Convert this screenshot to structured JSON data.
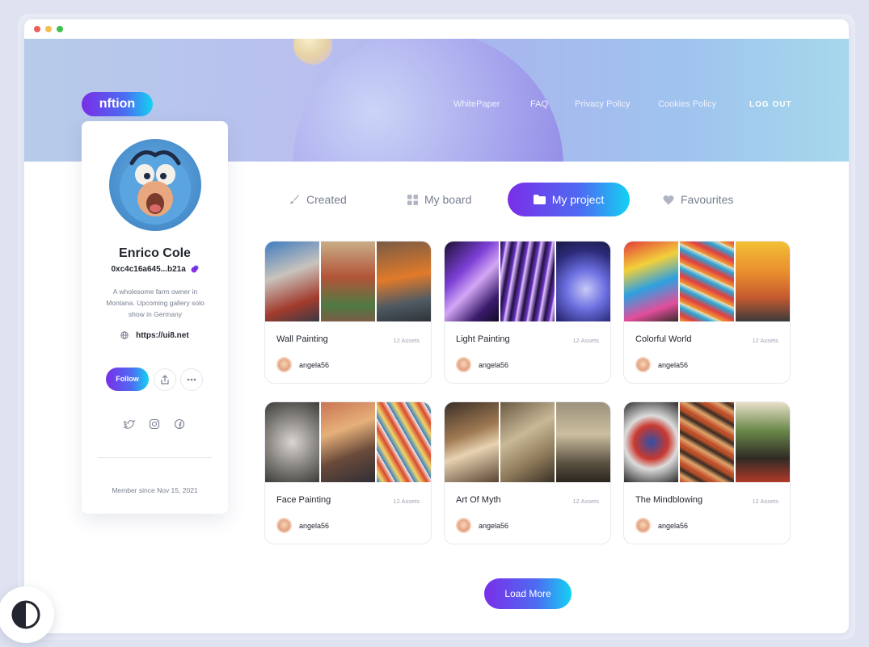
{
  "window": {
    "title_dots": [
      "close",
      "minimize",
      "maximize"
    ]
  },
  "brand": {
    "logo": "nftion"
  },
  "nav": {
    "items": [
      "WhitePaper",
      "FAQ",
      "Privacy Policy",
      "Cookies Policy"
    ],
    "logout": "LOG OUT"
  },
  "profile": {
    "name": "Enrico Cole",
    "wallet": "0xc4c16a645...b21a",
    "bio": "A wholesome farm owner in Montana. Upcoming gallery solo show in Germany",
    "website": "https://ui8.net",
    "follow_label": "Follow",
    "member_since": "Member since Nov 15, 2021"
  },
  "tabs": [
    {
      "label": "Created",
      "icon": "brush-icon",
      "active": false
    },
    {
      "label": "My board",
      "icon": "grid-icon",
      "active": false
    },
    {
      "label": "My project",
      "icon": "folder-icon",
      "active": true
    },
    {
      "label": "Favourites",
      "icon": "heart-icon",
      "active": false
    }
  ],
  "projects": [
    {
      "title": "Wall Painting",
      "assets": "12 Assets",
      "user": "angela56"
    },
    {
      "title": "Light Painting",
      "assets": "12 Assets",
      "user": "angela56"
    },
    {
      "title": "Colorful World",
      "assets": "12 Assets",
      "user": "angela56"
    },
    {
      "title": "Face Painting",
      "assets": "12 Assets",
      "user": "angela56"
    },
    {
      "title": "Art Of Myth",
      "assets": "12 Assets",
      "user": "angela56"
    },
    {
      "title": "The Mindblowing",
      "assets": "12 Assets",
      "user": "angela56"
    }
  ],
  "load_more": "Load More",
  "colors": {
    "accent_start": "#7a2ee8",
    "accent_end": "#13d2f3",
    "text_dark": "#23262f",
    "text_muted": "#777e90"
  }
}
